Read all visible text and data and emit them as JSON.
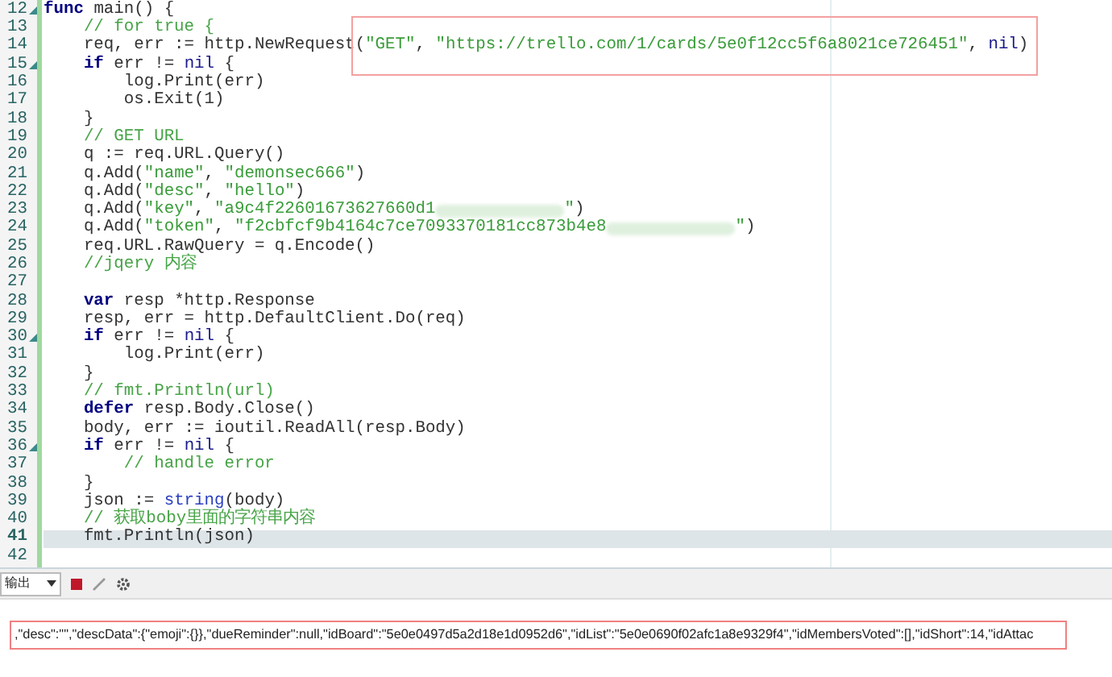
{
  "editor": {
    "lines": [
      {
        "number": "12",
        "fold": true,
        "tokens": [
          {
            "kind": "kw",
            "text": "func"
          },
          {
            "kind": "plain",
            "text": " main() {"
          }
        ]
      },
      {
        "number": "13",
        "tokens": [
          {
            "kind": "cmt",
            "text": "    // for true {"
          }
        ]
      },
      {
        "number": "14",
        "tokens": [
          {
            "kind": "plain",
            "text": "    req, err := http.NewRequest"
          }
        ],
        "boxed_tokens": [
          {
            "kind": "plain",
            "text": "("
          },
          {
            "kind": "str",
            "text": "\"GET\""
          },
          {
            "kind": "plain",
            "text": ", "
          },
          {
            "kind": "str",
            "text": "\"https://trello.com/1/cards/5e0f12cc5f6a8021ce726451\""
          },
          {
            "kind": "plain",
            "text": ", "
          },
          {
            "kind": "const",
            "text": "nil"
          },
          {
            "kind": "plain",
            "text": ")"
          }
        ]
      },
      {
        "number": "15",
        "fold": true,
        "tokens": [
          {
            "kind": "kw",
            "text": "    if"
          },
          {
            "kind": "plain",
            "text": " err != "
          },
          {
            "kind": "const",
            "text": "nil"
          },
          {
            "kind": "plain",
            "text": " {"
          }
        ]
      },
      {
        "number": "16",
        "tokens": [
          {
            "kind": "plain",
            "text": "        log.Print(err)"
          }
        ]
      },
      {
        "number": "17",
        "tokens": [
          {
            "kind": "plain",
            "text": "        os.Exit(1)"
          }
        ]
      },
      {
        "number": "18",
        "tokens": [
          {
            "kind": "plain",
            "text": "    }"
          }
        ]
      },
      {
        "number": "19",
        "tokens": [
          {
            "kind": "cmt",
            "text": "    // GET URL"
          }
        ]
      },
      {
        "number": "20",
        "tokens": [
          {
            "kind": "plain",
            "text": "    q := req.URL.Query()"
          }
        ]
      },
      {
        "number": "21",
        "tokens": [
          {
            "kind": "plain",
            "text": "    q.Add("
          },
          {
            "kind": "str",
            "text": "\"name\""
          },
          {
            "kind": "plain",
            "text": ", "
          },
          {
            "kind": "str",
            "text": "\"demonsec666\""
          },
          {
            "kind": "plain",
            "text": ")"
          }
        ]
      },
      {
        "number": "22",
        "tokens": [
          {
            "kind": "plain",
            "text": "    q.Add("
          },
          {
            "kind": "str",
            "text": "\"desc\""
          },
          {
            "kind": "plain",
            "text": ", "
          },
          {
            "kind": "str",
            "text": "\"hello\""
          },
          {
            "kind": "plain",
            "text": ")"
          }
        ]
      },
      {
        "number": "23",
        "tokens": [
          {
            "kind": "plain",
            "text": "    q.Add("
          },
          {
            "kind": "str",
            "text": "\"key\""
          },
          {
            "kind": "plain",
            "text": ", "
          },
          {
            "kind": "str",
            "text": "\"a9c4f22601673627660d1"
          },
          {
            "kind": "redacted"
          },
          {
            "kind": "str",
            "text": "\""
          },
          {
            "kind": "plain",
            "text": ")"
          }
        ]
      },
      {
        "number": "24",
        "tokens": [
          {
            "kind": "plain",
            "text": "    q.Add("
          },
          {
            "kind": "str",
            "text": "\"token\""
          },
          {
            "kind": "plain",
            "text": ", "
          },
          {
            "kind": "str",
            "text": "\"f2cbfcf9b4164c7ce7093370181cc873b4e8"
          },
          {
            "kind": "redacted"
          },
          {
            "kind": "str",
            "text": "\""
          },
          {
            "kind": "plain",
            "text": ")"
          }
        ]
      },
      {
        "number": "25",
        "tokens": [
          {
            "kind": "plain",
            "text": "    req.URL.RawQuery = q.Encode()"
          }
        ]
      },
      {
        "number": "26",
        "tokens": [
          {
            "kind": "cmt",
            "text": "    //jqery 内容"
          }
        ]
      },
      {
        "number": "27"
      },
      {
        "number": "28",
        "tokens": [
          {
            "kind": "kw",
            "text": "    var"
          },
          {
            "kind": "plain",
            "text": " resp *http.Response"
          }
        ]
      },
      {
        "number": "29",
        "tokens": [
          {
            "kind": "plain",
            "text": "    resp, err = http.DefaultClient.Do(req)"
          }
        ]
      },
      {
        "number": "30",
        "fold": true,
        "tokens": [
          {
            "kind": "kw",
            "text": "    if"
          },
          {
            "kind": "plain",
            "text": " err != "
          },
          {
            "kind": "const",
            "text": "nil"
          },
          {
            "kind": "plain",
            "text": " {"
          }
        ]
      },
      {
        "number": "31",
        "tokens": [
          {
            "kind": "plain",
            "text": "        log.Print(err)"
          }
        ]
      },
      {
        "number": "32",
        "tokens": [
          {
            "kind": "plain",
            "text": "    }"
          }
        ]
      },
      {
        "number": "33",
        "tokens": [
          {
            "kind": "cmt",
            "text": "    // fmt.Println(url)"
          }
        ]
      },
      {
        "number": "34",
        "tokens": [
          {
            "kind": "kw",
            "text": "    defer"
          },
          {
            "kind": "plain",
            "text": " resp.Body.Close()"
          }
        ]
      },
      {
        "number": "35",
        "tokens": [
          {
            "kind": "plain",
            "text": "    body, err := ioutil.ReadAll(resp.Body)"
          }
        ]
      },
      {
        "number": "36",
        "fold": true,
        "tokens": [
          {
            "kind": "kw",
            "text": "    if"
          },
          {
            "kind": "plain",
            "text": " err != "
          },
          {
            "kind": "const",
            "text": "nil"
          },
          {
            "kind": "plain",
            "text": " {"
          }
        ]
      },
      {
        "number": "37",
        "tokens": [
          {
            "kind": "cmt",
            "text": "        // handle error"
          }
        ]
      },
      {
        "number": "38",
        "tokens": [
          {
            "kind": "plain",
            "text": "    }"
          }
        ]
      },
      {
        "number": "39",
        "tokens": [
          {
            "kind": "plain",
            "text": "    json := "
          },
          {
            "kind": "builtin",
            "text": "string"
          },
          {
            "kind": "plain",
            "text": "(body)"
          }
        ]
      },
      {
        "number": "40",
        "tokens": [
          {
            "kind": "cmt",
            "text": "    // 获取boby里面的字符串内容"
          }
        ]
      },
      {
        "number": "41",
        "current": true,
        "tokens": [
          {
            "kind": "plain",
            "text": "    fmt.Println(json)"
          }
        ]
      },
      {
        "number": "42"
      }
    ]
  },
  "output_panel": {
    "selector": "输出",
    "text": ",\"desc\":\"\",\"descData\":{\"emoji\":{}},\"dueReminder\":null,\"idBoard\":\"5e0e0497d5a2d18e1d0952d6\",\"idList\":\"5e0e0690f02afc1a8e9329f4\",\"idMembersVoted\":[],\"idShort\":14,\"idAttac"
  }
}
